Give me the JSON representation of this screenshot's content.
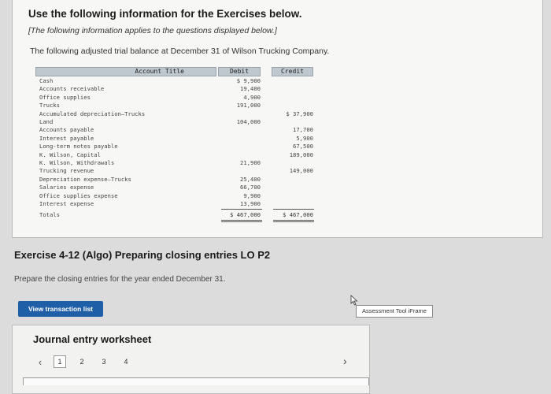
{
  "header": {
    "title": "Use the following information for the Exercises below.",
    "subtitle": "[The following information applies to the questions displayed below.]",
    "intro": "The following adjusted trial balance at December 31 of Wilson Trucking Company."
  },
  "trial_balance": {
    "col_account": "Account Title",
    "col_debit": "Debit",
    "col_credit": "Credit",
    "rows": [
      {
        "account": "Cash",
        "debit": "$ 9,900",
        "credit": ""
      },
      {
        "account": "Accounts receivable",
        "debit": "19,400",
        "credit": ""
      },
      {
        "account": "Office supplies",
        "debit": "4,900",
        "credit": ""
      },
      {
        "account": "Trucks",
        "debit": "191,000",
        "credit": ""
      },
      {
        "account": "Accumulated depreciation–Trucks",
        "debit": "",
        "credit": "$ 37,900"
      },
      {
        "account": "Land",
        "debit": "104,000",
        "credit": ""
      },
      {
        "account": "Accounts payable",
        "debit": "",
        "credit": "17,700"
      },
      {
        "account": "Interest payable",
        "debit": "",
        "credit": "5,900"
      },
      {
        "account": "Long-term notes payable",
        "debit": "",
        "credit": "67,500"
      },
      {
        "account": "K. Wilson, Capital",
        "debit": "",
        "credit": "189,000"
      },
      {
        "account": "K. Wilson, Withdrawals",
        "debit": "21,900",
        "credit": ""
      },
      {
        "account": "Trucking revenue",
        "debit": "",
        "credit": "149,000"
      },
      {
        "account": "Depreciation expense–Trucks",
        "debit": "25,400",
        "credit": ""
      },
      {
        "account": "Salaries expense",
        "debit": "66,700",
        "credit": ""
      },
      {
        "account": "Office supplies expense",
        "debit": "9,900",
        "credit": ""
      },
      {
        "account": "Interest expense",
        "debit": "13,900",
        "credit": ""
      }
    ],
    "totals": {
      "account": "Totals",
      "debit": "$ 467,000",
      "credit": "$ 467,000"
    }
  },
  "exercise": {
    "title": "Exercise 4-12 (Algo) Preparing closing entries LO P2",
    "prompt": "Prepare the closing entries for the year ended December 31."
  },
  "buttons": {
    "view_transactions": "View transaction list"
  },
  "assessment_tool": "Assessment Tool iFrame",
  "worksheet": {
    "title": "Journal entry worksheet",
    "prev_icon": "chevron-left-icon",
    "next_icon": "chevron-right-icon",
    "pages": [
      "1",
      "2",
      "3",
      "4"
    ],
    "active_page": "1"
  },
  "colors": {
    "button_blue": "#1f5fa8",
    "table_header": "#bfc7cf"
  }
}
